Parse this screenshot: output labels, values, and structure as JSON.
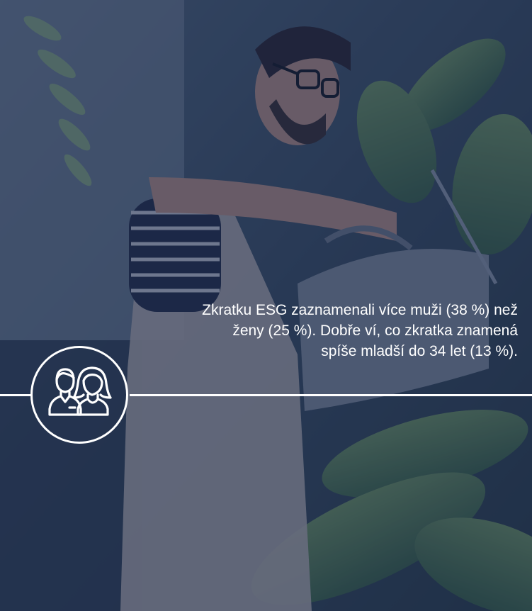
{
  "caption": {
    "line1": "Zkratku ESG zaznamenali více muži (38 %) než",
    "line2": "ženy (25 %). Dobře ví, co zkratka znamená",
    "line3": "spíše mladší do 34 let (13 %)."
  },
  "icons": {
    "badge": "man-and-woman-icon"
  },
  "colors": {
    "overlay": "#172852",
    "text": "#ffffff"
  }
}
